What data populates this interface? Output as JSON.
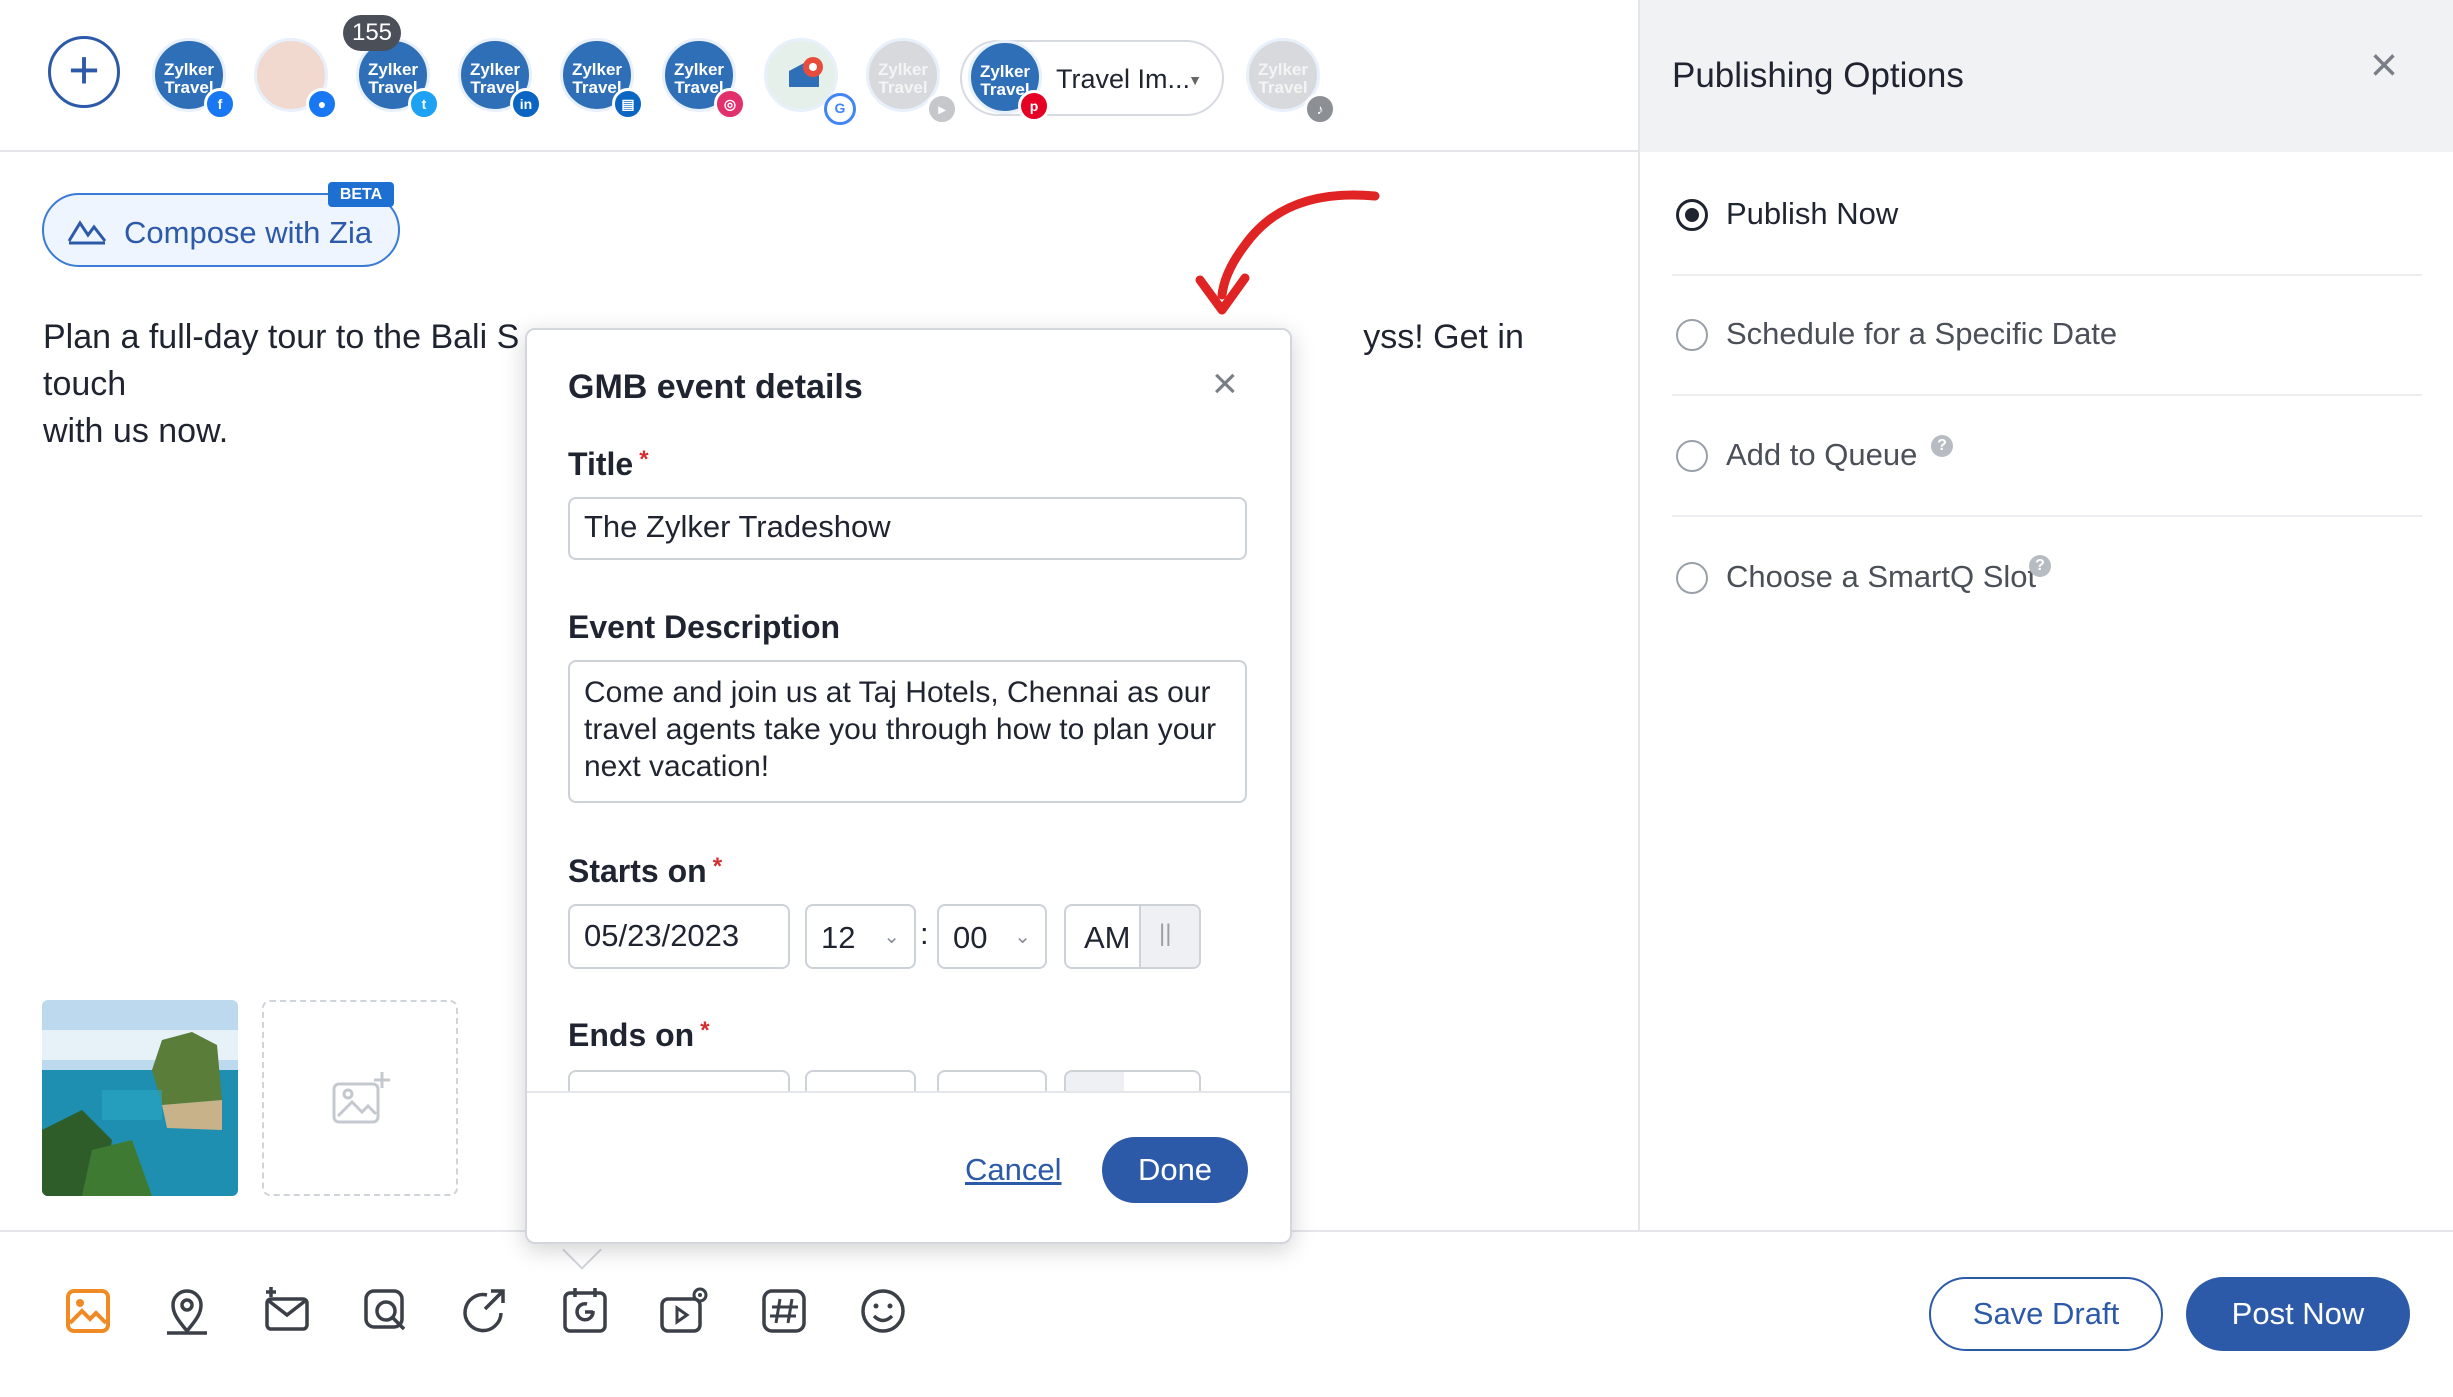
{
  "header": {
    "notification_count": "155",
    "selected_account_label": "Travel Im...",
    "avatar_text": "Zylker Travel",
    "channels": [
      {
        "name": "facebook",
        "badge_color": "#1877f2"
      },
      {
        "name": "facebook-group",
        "badge_color": "#1877f2"
      },
      {
        "name": "twitter",
        "badge_color": "#1da1f2"
      },
      {
        "name": "linkedin",
        "badge_color": "#0a66c2"
      },
      {
        "name": "linkedin-page",
        "badge_color": "#0a66c2"
      },
      {
        "name": "instagram",
        "badge_color": "#e1306c"
      },
      {
        "name": "google-business",
        "badge_color": "#4285f4"
      },
      {
        "name": "youtube",
        "badge_color": "#c6c7ca"
      },
      {
        "name": "pinterest",
        "badge_color": "#e60023"
      },
      {
        "name": "tiktok",
        "badge_color": "#8c8f94"
      }
    ]
  },
  "composer": {
    "zia_label": "Compose with Zia",
    "beta_label": "BETA",
    "post_text": "Plan a full-day tour to the Bali Saba and be amazed the marine wonders of the abyss! Get in touch with us now.",
    "post_text_visible_line1_left": "Plan a full-day tour to the Bali S",
    "post_text_visible_line1_right": "yss! Get in touch",
    "post_text_visible_line2": "with us now."
  },
  "toolbar": {
    "tools": [
      "image-icon",
      "location-icon",
      "mail-plus-icon",
      "search-image-icon",
      "share-icon",
      "gmb-event-icon",
      "video-settings-icon",
      "hashtag-icon",
      "emoji-icon"
    ],
    "save_draft_label": "Save Draft",
    "post_now_label": "Post Now",
    "accent_color": "#2d5aa8",
    "active_tool_color": "#f08a24"
  },
  "publishing_panel": {
    "title": "Publishing Options",
    "options": [
      {
        "label": "Publish Now",
        "selected": true
      },
      {
        "label": "Schedule for a Specific Date",
        "selected": false
      },
      {
        "label": "Add to Queue",
        "selected": false,
        "help": "?"
      },
      {
        "label": "Choose a SmartQ Slot",
        "selected": false,
        "help": "?"
      }
    ]
  },
  "dialog": {
    "title": "GMB event details",
    "title_label": "Title",
    "title_value": "The Zylker Tradeshow",
    "required_marker": "*",
    "description_label": "Event Description",
    "description_value": "Come and join us at Taj Hotels, Chennai as our travel agents take you through how to plan your next vacation!",
    "starts_on_label": "Starts on",
    "start_date": "05/23/2023",
    "start_hour": "12",
    "start_minute": "00",
    "time_separator": ":",
    "start_period": "AM",
    "ends_on_label": "Ends on",
    "cancel_label": "Cancel",
    "done_label": "Done"
  }
}
